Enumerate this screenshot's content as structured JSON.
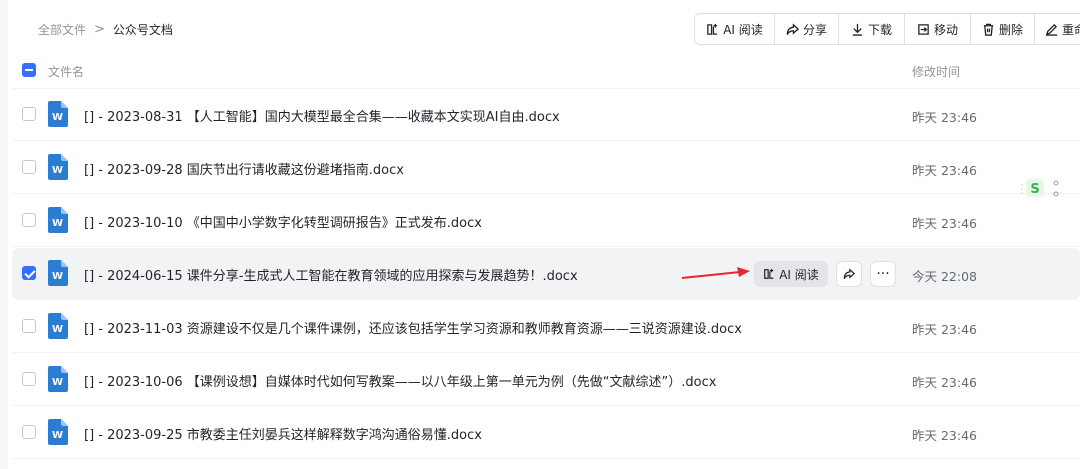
{
  "breadcrumb": {
    "root": "全部文件",
    "separator": ">",
    "current": "公众号文档"
  },
  "toolbar": {
    "ai_read": "AI 阅读",
    "share": "分享",
    "download": "下载",
    "move": "移动",
    "delete": "删除",
    "rename": "重命"
  },
  "table": {
    "col_name": "文件名",
    "col_modified": "修改时间"
  },
  "files": [
    {
      "name": "[] - 2023-08-31 【人工智能】国内大模型最全合集——收藏本文实现AI自由.docx",
      "modified": "昨天 23:46",
      "checked": false
    },
    {
      "name": "[] - 2023-09-28 国庆节出行请收藏这份避堵指南.docx",
      "modified": "昨天 23:46",
      "checked": false
    },
    {
      "name": "[] - 2023-10-10 《中国中小学数字化转型调研报告》正式发布.docx",
      "modified": "昨天 23:46",
      "checked": false
    },
    {
      "name": "[] - 2024-06-15 课件分享-生成式人工智能在教育领域的应用探索与发展趋势！.docx",
      "modified": "今天 22:08",
      "checked": true
    },
    {
      "name": "[] - 2023-11-03 资源建设不仅是几个课件课例，还应该包括学生学习资源和教师教育资源——三说资源建设.docx",
      "modified": "昨天 23:46",
      "checked": false
    },
    {
      "name": "[] - 2023-10-06 【课例设想】自媒体时代如何写教案——以八年级上第一单元为例（先做“文献综述”）.docx",
      "modified": "昨天 23:46",
      "checked": false
    },
    {
      "name": "[] - 2023-09-25 市教委主任刘晏兵这样解释数字鸿沟通俗易懂.docx",
      "modified": "昨天 23:46",
      "checked": false
    }
  ],
  "row_actions": {
    "ai_read": "AI 阅读",
    "more": "···"
  },
  "icons": {
    "file_type": "word-doc-icon",
    "word_letter": "W",
    "word_color": "#2b7cd3"
  },
  "colors": {
    "accent": "#3370ff",
    "arrow": "#e8262b"
  }
}
